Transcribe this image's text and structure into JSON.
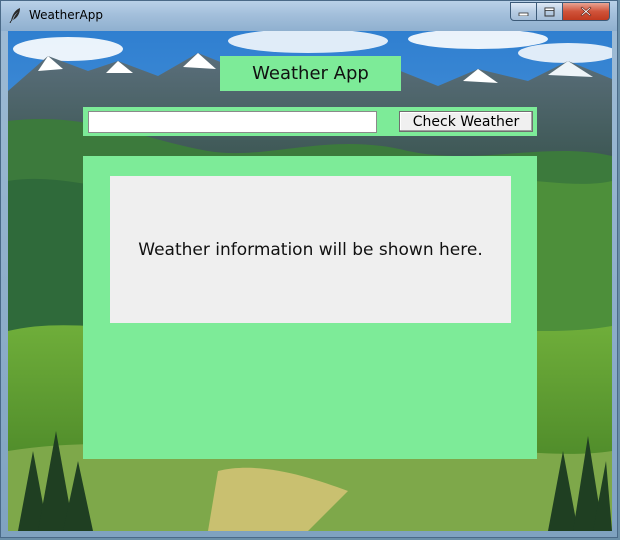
{
  "window": {
    "title": "WeatherApp",
    "icon": "feather-icon",
    "controls": [
      "minimize-icon",
      "maximize-icon",
      "close-icon"
    ]
  },
  "app": {
    "header": "Weather App",
    "search": {
      "value": "",
      "placeholder": ""
    },
    "check_button_label": "Check Weather",
    "info_text": "Weather information will be shown here."
  },
  "colors": {
    "panel_green": "#7deb98",
    "info_box_bg": "#efefef",
    "close_button_red": "#c0391f"
  }
}
